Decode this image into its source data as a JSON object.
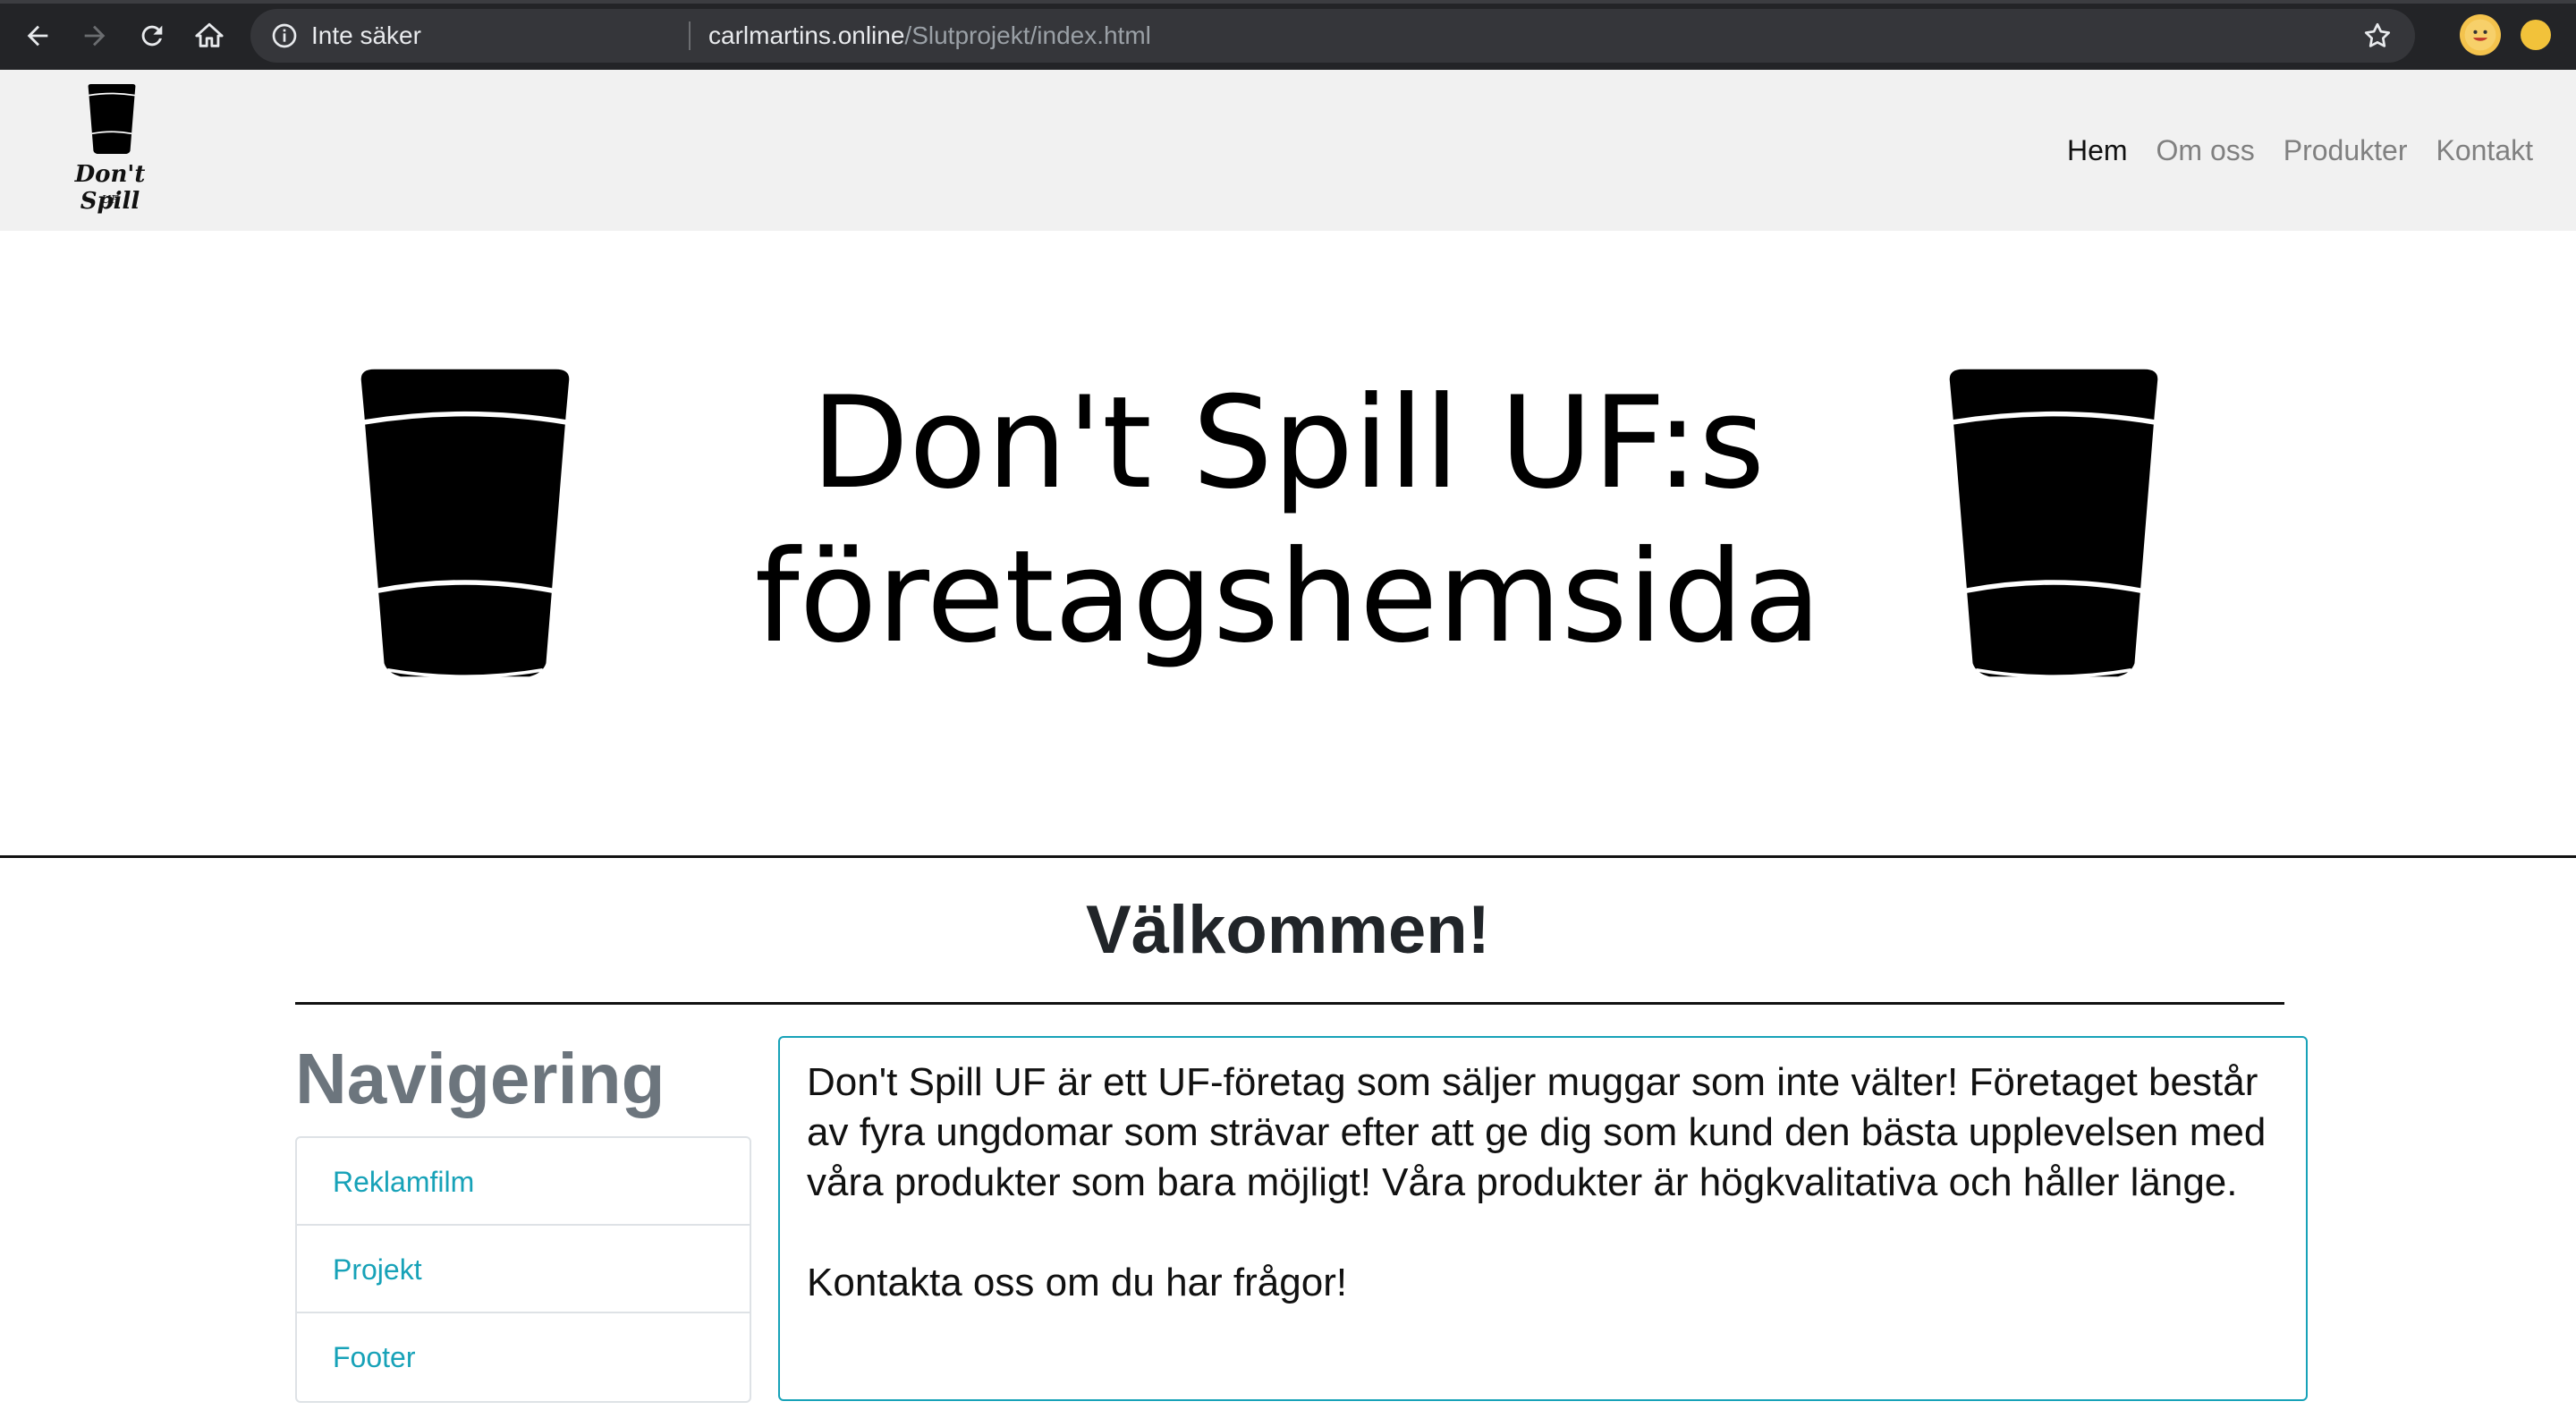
{
  "browser": {
    "security_label": "Inte säker",
    "url_host": "carlmartins.online",
    "url_path": "/Slutprojekt/index.html"
  },
  "navbar": {
    "brand_name": "Don't Spill",
    "brand_sub": "UF",
    "links": [
      {
        "label": "Hem",
        "active": true
      },
      {
        "label": "Om oss",
        "active": false
      },
      {
        "label": "Produkter",
        "active": false
      },
      {
        "label": "Kontakt",
        "active": false
      }
    ]
  },
  "hero": {
    "title_line1": "Don't Spill UF:s",
    "title_line2": "företagshemsida"
  },
  "welcome": {
    "heading": "Välkommen!"
  },
  "sidebar": {
    "title": "Navigering",
    "items": [
      "Reklamfilm",
      "Projekt",
      "Footer"
    ]
  },
  "card": {
    "paragraph1": "Don't Spill UF är ett UF-företag som säljer muggar som inte välter! Företaget består av fyra ungdomar som strävar efter att ge dig som kund den bästa upplevelsen med våra produkter som bara möjligt! Våra produkter är högkvalitativa och håller länge.",
    "paragraph2": "Kontakta oss om du har frågor!"
  },
  "colors": {
    "accent": "#17a2b8",
    "nav_bg": "#f1f1f1",
    "muted": "#6c757d"
  }
}
